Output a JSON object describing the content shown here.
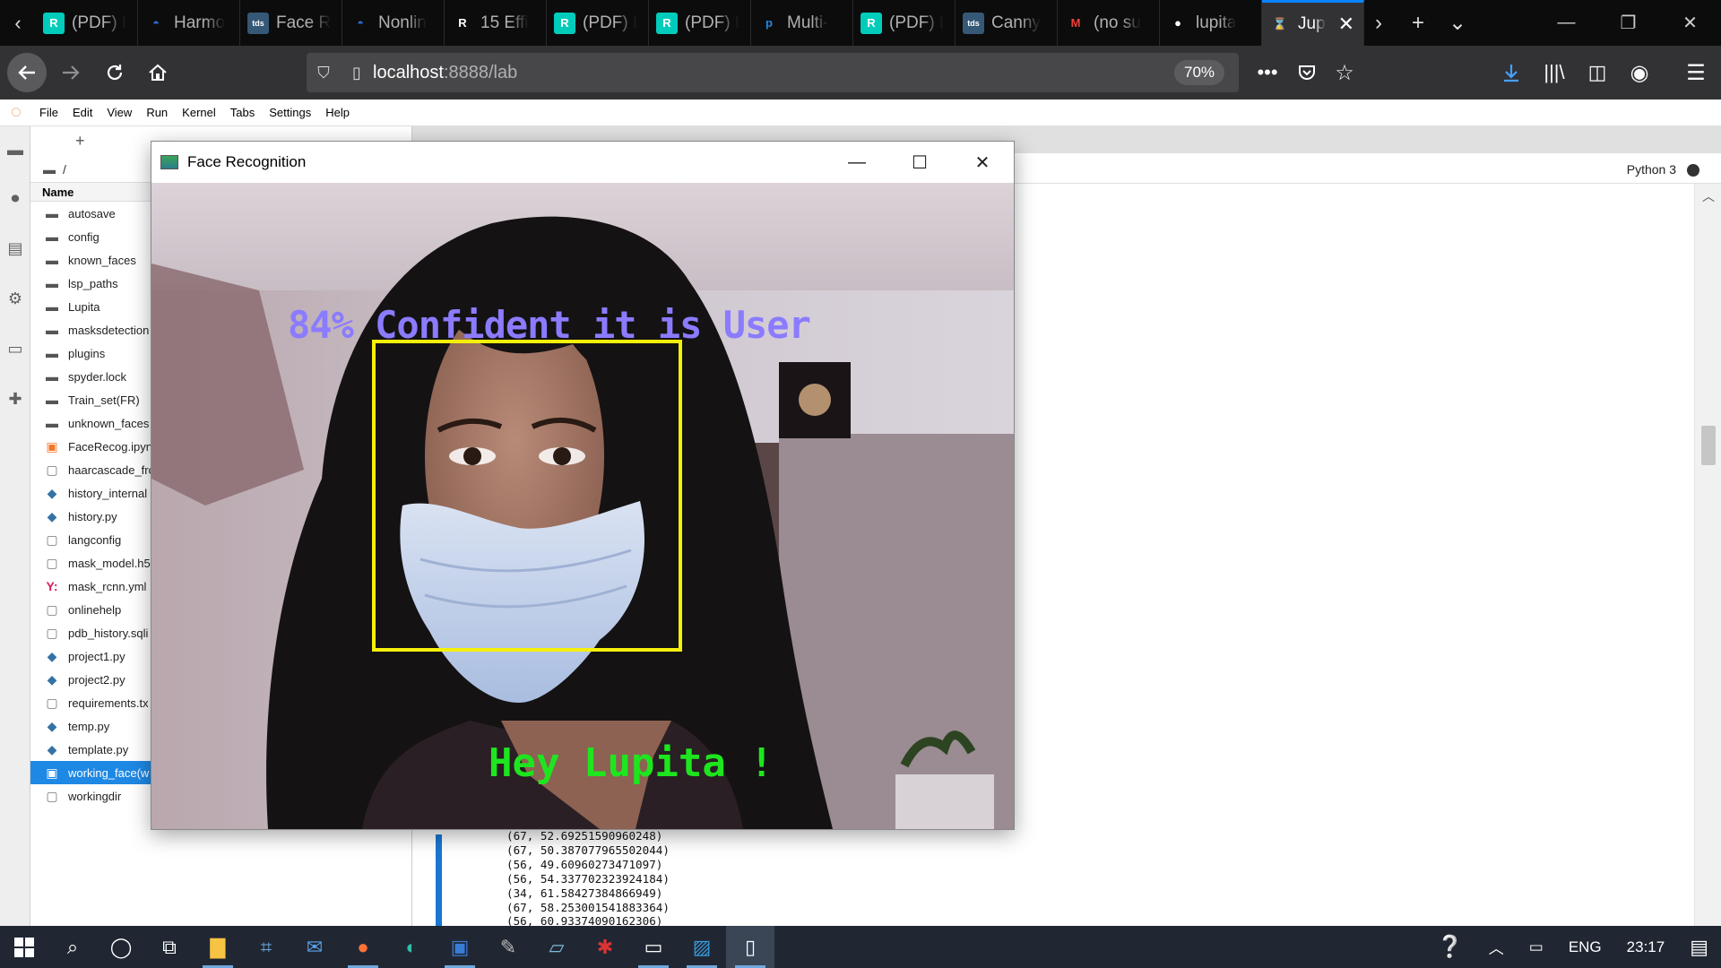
{
  "browser": {
    "tabs": [
      {
        "label": "(PDF) I",
        "icon": "researchgate-icon",
        "color": "#00ccbb"
      },
      {
        "label": "Harmo",
        "icon": "harmony-icon",
        "color": "#2c6ed5"
      },
      {
        "label": "Face R",
        "icon": "tds-icon",
        "color": "#355876"
      },
      {
        "label": "Nonlin",
        "icon": "nonlinear-icon",
        "color": "#2c6ed5"
      },
      {
        "label": "15 Effi",
        "icon": "r-icon",
        "color": "#ffffff"
      },
      {
        "label": "(PDF) I",
        "icon": "researchgate-icon",
        "color": "#00ccbb"
      },
      {
        "label": "(PDF) I",
        "icon": "researchgate-icon",
        "color": "#00ccbb"
      },
      {
        "label": "Multi-",
        "icon": "p-icon",
        "color": "#1e88e5"
      },
      {
        "label": "(PDF) I",
        "icon": "researchgate-icon",
        "color": "#00ccbb"
      },
      {
        "label": "Canny",
        "icon": "tds-icon",
        "color": "#355876"
      },
      {
        "label": "(no su",
        "icon": "gmail-icon",
        "color": "#ea4335"
      },
      {
        "label": "lupita",
        "icon": "github-icon",
        "color": "#ffffff"
      },
      {
        "label": "Jup",
        "icon": "hourglass-icon",
        "color": "#f37626"
      }
    ],
    "url_host": "localhost",
    "url_rest": ":8888/lab",
    "zoom": "70%"
  },
  "jupyter": {
    "menu": [
      "File",
      "Edit",
      "View",
      "Run",
      "Kernel",
      "Tabs",
      "Settings",
      "Help"
    ],
    "breadcrumb": "/",
    "name_header": "Name",
    "files": [
      {
        "name": "autosave",
        "type": "folder"
      },
      {
        "name": "config",
        "type": "folder"
      },
      {
        "name": "known_faces",
        "type": "folder"
      },
      {
        "name": "lsp_paths",
        "type": "folder"
      },
      {
        "name": "Lupita",
        "type": "folder"
      },
      {
        "name": "masksdetection",
        "type": "folder"
      },
      {
        "name": "plugins",
        "type": "folder"
      },
      {
        "name": "spyder.lock",
        "type": "folder"
      },
      {
        "name": "Train_set(FR)",
        "type": "folder"
      },
      {
        "name": "unknown_faces",
        "type": "folder"
      },
      {
        "name": "FaceRecog.ipynb",
        "type": "notebook"
      },
      {
        "name": "haarcascade_fro",
        "type": "file"
      },
      {
        "name": "history_internal",
        "type": "python"
      },
      {
        "name": "history.py",
        "type": "python"
      },
      {
        "name": "langconfig",
        "type": "file"
      },
      {
        "name": "mask_model.h5",
        "type": "file"
      },
      {
        "name": "mask_rcnn.yml",
        "type": "yaml"
      },
      {
        "name": "onlinehelp",
        "type": "file"
      },
      {
        "name": "pdb_history.sqli",
        "type": "file"
      },
      {
        "name": "project1.py",
        "type": "python"
      },
      {
        "name": "project2.py",
        "type": "python"
      },
      {
        "name": "requirements.tx",
        "type": "file"
      },
      {
        "name": "temp.py",
        "type": "python"
      },
      {
        "name": "template.py",
        "type": "python"
      },
      {
        "name": "working_face(w",
        "type": "notebook",
        "selected": true
      },
      {
        "name": "workingdir",
        "type": "file"
      }
    ],
    "kernel": "Python 3",
    "output_lines": [
      "(67, 52.69251590960248)",
      "(67, 50.387077965502044)",
      "(56, 49.60960273471097)",
      "(56, 54.337702323924184)",
      "(34, 61.58427384866949)",
      "(67, 58.253001541883364)",
      "(56, 60.93374090162306)"
    ]
  },
  "face_window": {
    "title": "Face Recognition",
    "confidence_text": "84% Confident it is User",
    "greeting_text": "Hey Lupita !",
    "box_color": "#f5f00a",
    "confidence_color": "#8b7bff",
    "greeting_color": "#1ee61e"
  },
  "taskbar": {
    "language": "ENG",
    "time": "23:17"
  }
}
